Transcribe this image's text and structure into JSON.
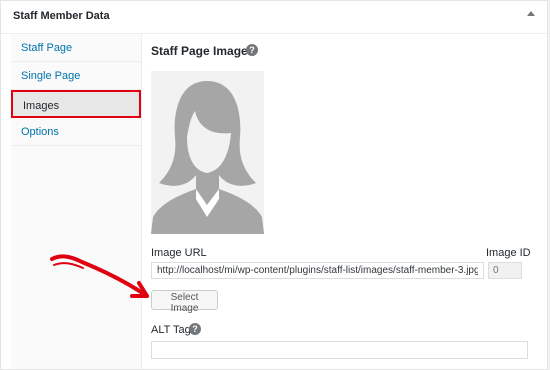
{
  "panel": {
    "title": "Staff Member Data"
  },
  "tabs": [
    {
      "label": "Staff Page",
      "active": false
    },
    {
      "label": "Single Page",
      "active": false
    },
    {
      "label": "Images",
      "active": true
    },
    {
      "label": "Options",
      "active": false
    }
  ],
  "image_section": {
    "title": "Staff Page Image",
    "url_label": "Image URL",
    "url_value": "http://localhost/mi/wp-content/plugins/staff-list/images/staff-member-3.jpg",
    "id_label": "Image ID",
    "id_value": "0",
    "button_label": "Select Image",
    "alt_label": "ALT Tag",
    "alt_value": ""
  },
  "icons": {
    "help": "question-circle-icon",
    "toggle": "toggle-arrow-icon",
    "avatar": "placeholder-woman-silhouette"
  },
  "colors": {
    "accent_link": "#0073aa",
    "highlight": "#e0000f",
    "avatar_fill": "#a6a6a6"
  }
}
